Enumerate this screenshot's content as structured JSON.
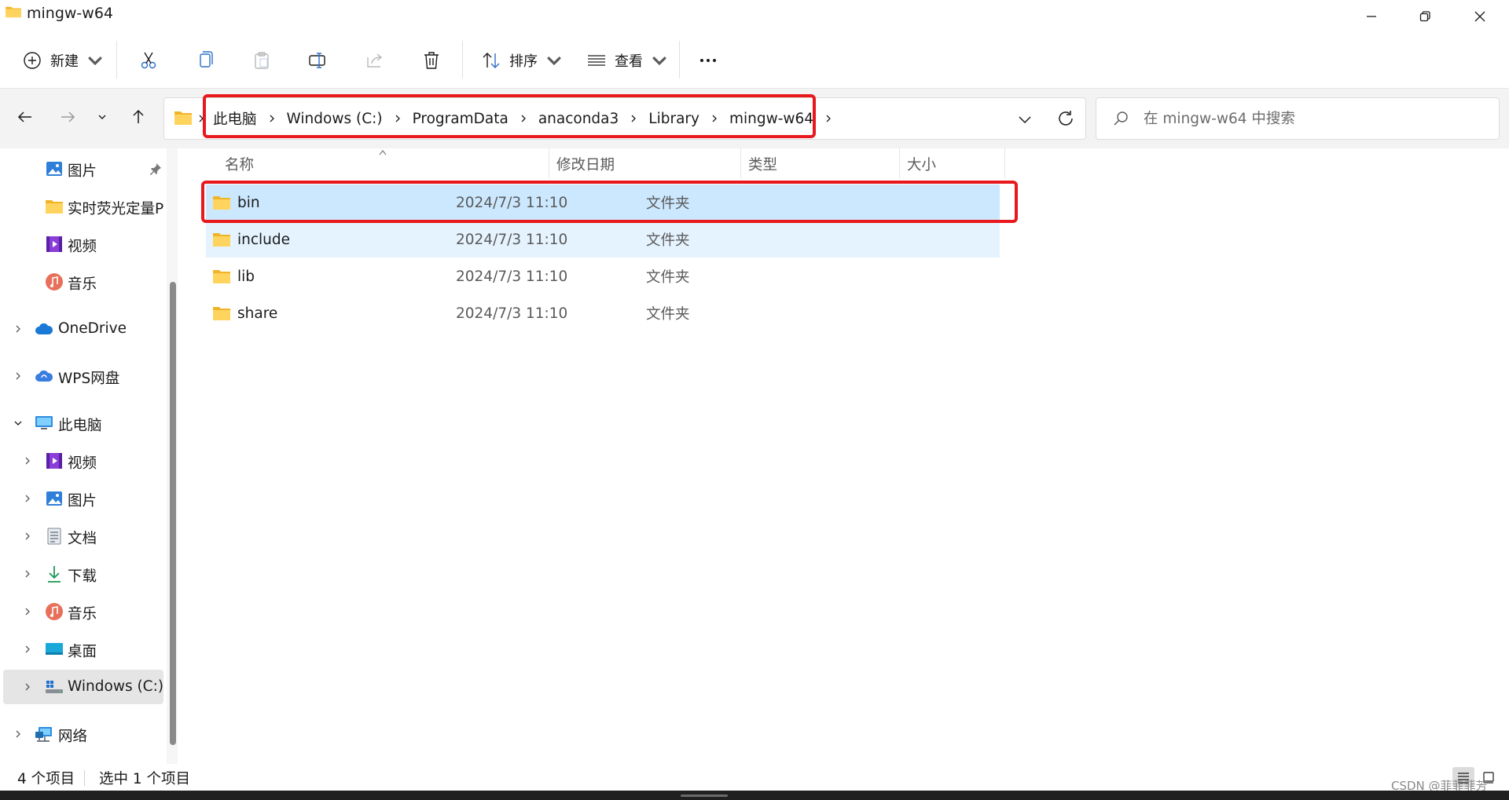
{
  "window": {
    "title": "mingw-w64"
  },
  "toolbar": {
    "new_label": "新建",
    "sort_label": "排序",
    "view_label": "查看"
  },
  "address": {
    "crumbs": [
      "此电脑",
      "Windows (C:)",
      "ProgramData",
      "anaconda3",
      "Library",
      "mingw-w64"
    ]
  },
  "search": {
    "placeholder": "在 mingw-w64 中搜索"
  },
  "navpane": {
    "quick": [
      {
        "label": "图片",
        "icon": "pictures-icon",
        "pinned": true
      },
      {
        "label": "实时荧光定量PCR",
        "icon": "folder-icon"
      },
      {
        "label": "视频",
        "icon": "videos-icon"
      },
      {
        "label": "音乐",
        "icon": "music-icon"
      }
    ],
    "onedrive": "OneDrive",
    "wps": "WPS网盘",
    "thispc": "此电脑",
    "pc_children": [
      {
        "label": "视频",
        "icon": "videos-icon"
      },
      {
        "label": "图片",
        "icon": "pictures-icon"
      },
      {
        "label": "文档",
        "icon": "documents-icon"
      },
      {
        "label": "下载",
        "icon": "downloads-icon"
      },
      {
        "label": "音乐",
        "icon": "music-icon"
      },
      {
        "label": "桌面",
        "icon": "desktop-icon"
      },
      {
        "label": "Windows (C:)",
        "icon": "drive-icon",
        "selected": true
      }
    ],
    "network": "网络"
  },
  "columns": {
    "name": "名称",
    "date": "修改日期",
    "type": "类型",
    "size": "大小"
  },
  "files": [
    {
      "name": "bin",
      "date": "2024/7/3 11:10",
      "type": "文件夹",
      "state": "selected"
    },
    {
      "name": "include",
      "date": "2024/7/3 11:10",
      "type": "文件夹",
      "state": "hover"
    },
    {
      "name": "lib",
      "date": "2024/7/3 11:10",
      "type": "文件夹",
      "state": "normal"
    },
    {
      "name": "share",
      "date": "2024/7/3 11:10",
      "type": "文件夹",
      "state": "normal"
    }
  ],
  "status": {
    "count": "4 个项目",
    "selected": "选中 1 个项目"
  },
  "watermark": "CSDN @菲菲菲芳",
  "colors": {
    "accent": "#0067c0",
    "selection": "#cce8ff",
    "hover": "#e5f3ff",
    "annotation": "#e8191d",
    "folder": "#f8c94b"
  }
}
